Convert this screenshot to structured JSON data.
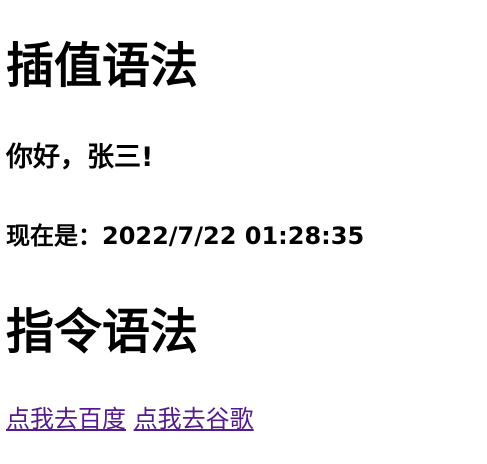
{
  "interpolation_section": {
    "title": "插值语法",
    "greeting": "你好，张三!",
    "time_text": "现在是：2022/7/22 01:28:35"
  },
  "directive_section": {
    "title": "指令语法",
    "links": [
      {
        "label": "点我去百度"
      },
      {
        "label": "点我去谷歌"
      }
    ]
  }
}
